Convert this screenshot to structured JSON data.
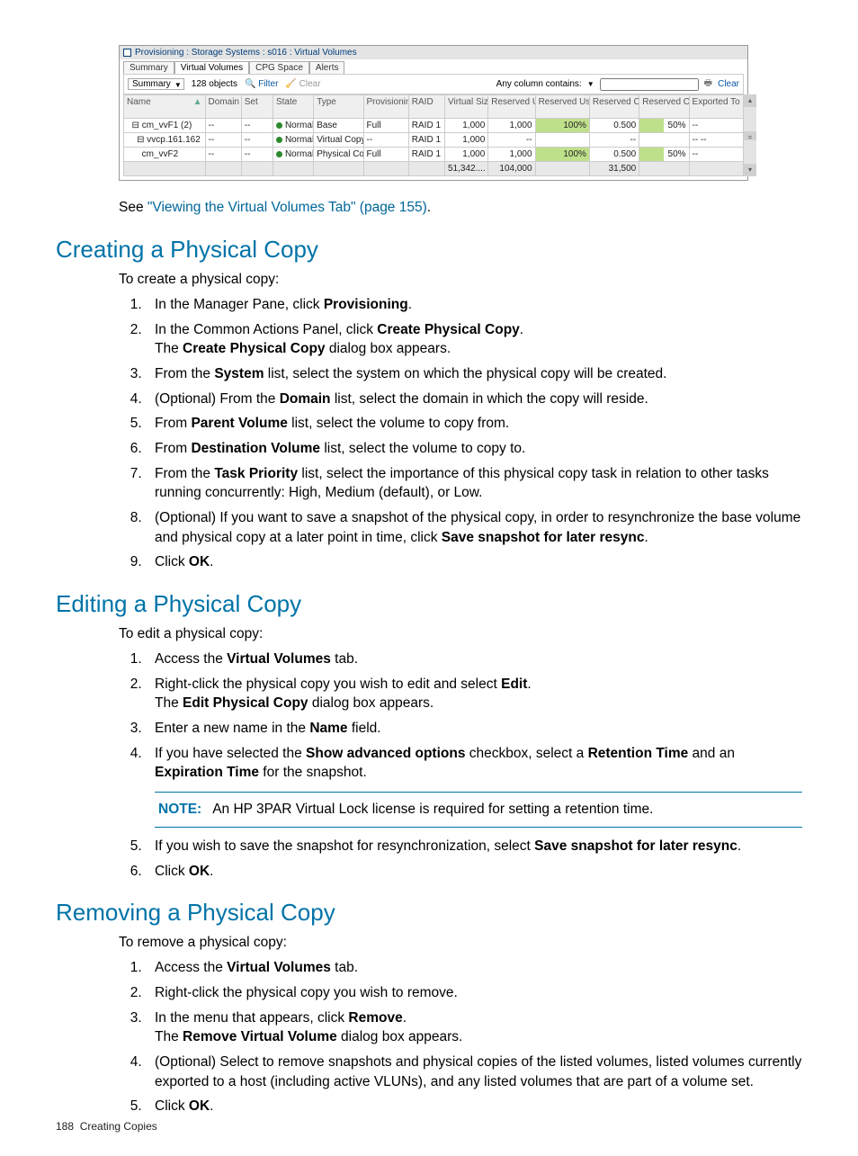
{
  "screenshot": {
    "breadcrumb": "Provisioning : Storage Systems : s016 : Virtual Volumes",
    "tabs": [
      "Summary",
      "Virtual Volumes",
      "CPG Space",
      "Alerts"
    ],
    "active_tab": 1,
    "toolbar": {
      "dropdown_label": "Summary",
      "objects_text": "128 objects",
      "filter_label": "Filter",
      "clear_label": "Clear",
      "any_column_label": "Any column contains:",
      "clear_right": "Clear"
    },
    "headers": [
      "Name",
      "Domain",
      "Set",
      "State",
      "Type",
      "Provisioning",
      "RAID",
      "Virtual Size (GB)",
      "Reserved User Size (GB)",
      "Reserved User Size (% Virtual)",
      "Reserved Copy Size (GB)",
      "Reserved Copy Size (% Virtual)",
      "Exported To"
    ],
    "rows": [
      {
        "name": "cm_vvF1 (2)",
        "domain": "--",
        "set": "--",
        "state": "Normal",
        "type": "Base",
        "prov": "Full",
        "raid": "RAID 1",
        "vsize": "1,000",
        "rusize": "1,000",
        "rupct": "100%",
        "rcsize": "0.500",
        "rcpct": "50%",
        "exp": "--",
        "indent": 1
      },
      {
        "name": "vvcp.161.162",
        "domain": "--",
        "set": "--",
        "state": "Normal",
        "type": "Virtual Copy",
        "prov": "--",
        "raid": "RAID 1",
        "vsize": "1,000",
        "rusize": "--",
        "rupct": "",
        "rcsize": "--",
        "rcpct": "",
        "exp": "--  --",
        "indent": 2
      },
      {
        "name": "cm_vvF2",
        "domain": "--",
        "set": "--",
        "state": "Normal",
        "type": "Physical Copy",
        "prov": "Full",
        "raid": "RAID 1",
        "vsize": "1,000",
        "rusize": "1,000",
        "rupct": "100%",
        "rcsize": "0.500",
        "rcpct": "50%",
        "exp": "--",
        "indent": 3
      }
    ],
    "footer": {
      "vsize": "51,342....",
      "rusize": "104,000",
      "rcsize": "31,500"
    }
  },
  "see_text_pre": "See ",
  "see_link": "\"Viewing the Virtual Volumes Tab\" (page 155)",
  "see_text_post": ".",
  "sections": {
    "create": {
      "title": "Creating a Physical Copy",
      "intro": "To create a physical copy:",
      "steps_html": [
        "In the Manager Pane, click <b>Provisioning</b>.",
        "In the Common Actions Panel, click <b>Create Physical Copy</b>.<br>The <b>Create Physical Copy</b> dialog box appears.",
        "From the <b>System</b> list, select the system on which the physical copy will be created.",
        "(Optional) From the <b>Domain</b> list, select the domain in which the copy will reside.",
        "From <b>Parent Volume</b> list, select the volume to copy from.",
        "From <b>Destination Volume</b> list, select the volume to copy to.",
        "From the <b>Task Priority</b> list, select the importance of this physical copy task in relation to other tasks running concurrently: High, Medium (default), or Low.",
        "(Optional) If you want to save a snapshot of the physical copy, in order to resynchronize the base volume and physical copy at a later point in time, click <b>Save snapshot for later resync</b>.",
        "Click <b>OK</b>."
      ]
    },
    "edit": {
      "title": "Editing a Physical Copy",
      "intro": "To edit a physical copy:",
      "steps_html": [
        "Access the <b>Virtual Volumes</b> tab.",
        "Right-click the physical copy you wish to edit and select <b>Edit</b>.<br>The <b>Edit Physical Copy</b> dialog box appears.",
        "Enter a new name in the <b>Name</b> field.",
        "If you have selected the <b>Show advanced options</b> checkbox, select a <b>Retention Time</b> and an <b>Expiration Time</b> for the snapshot."
      ],
      "note_label": "NOTE:",
      "note_text": "An HP 3PAR Virtual Lock license is required for setting a retention time.",
      "steps_after_html": [
        "If you wish to save the snapshot for resynchronization, select <b>Save snapshot for later resync</b>.",
        "Click <b>OK</b>."
      ]
    },
    "remove": {
      "title": "Removing a Physical Copy",
      "intro": "To remove a physical copy:",
      "steps_html": [
        "Access the <b>Virtual Volumes</b> tab.",
        "Right-click the physical copy you wish to remove.",
        "In the menu that appears, click <b>Remove</b>.<br>The <b>Remove Virtual Volume</b> dialog box appears.",
        "(Optional) Select to remove snapshots and physical copies of the listed volumes, listed volumes currently exported to a host (including active VLUNs), and any listed volumes that are part of a volume set.",
        "Click <b>OK</b>."
      ]
    }
  },
  "footer": {
    "page": "188",
    "section": "Creating Copies"
  }
}
